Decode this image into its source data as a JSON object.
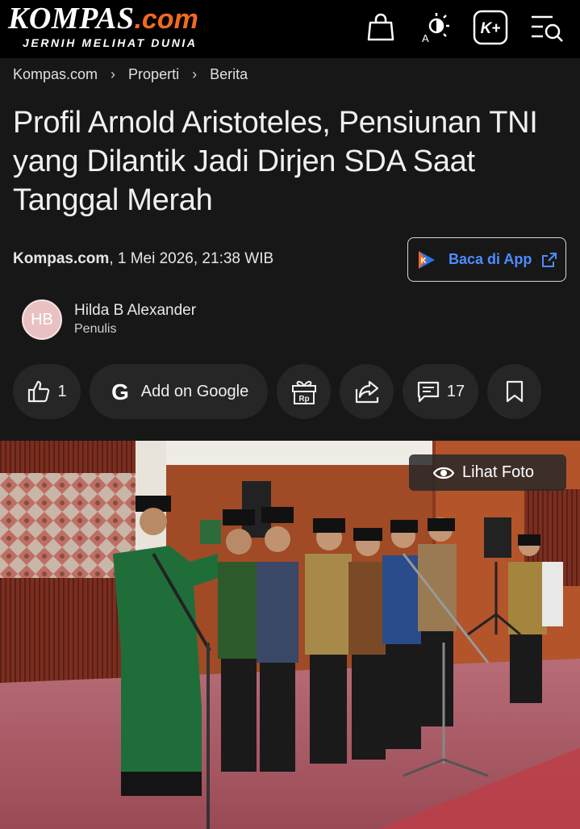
{
  "header": {
    "logo_main": "KOMPAS",
    "logo_domain": ".com",
    "logo_tagline": "JERNIH MELIHAT DUNIA",
    "icons": [
      "shopping-bag-icon",
      "brightness-auto-icon",
      "kplus-icon",
      "menu-search-icon"
    ],
    "kplus_label": "K+",
    "auto_label": "A"
  },
  "breadcrumb": {
    "items": [
      "Kompas.com",
      "Properti",
      "Berita"
    ],
    "separator": "›"
  },
  "article": {
    "title": "Profil Arnold Aristoteles, Pensiunan TNI yang Dilantik Jadi Dirjen SDA Saat Tanggal Merah",
    "source": "Kompas.com",
    "datetime": ", 1 Mei 2026, 21:38 WIB"
  },
  "app_button": {
    "label": "Baca di App",
    "logo_letter": "K"
  },
  "author": {
    "initials": "HB",
    "name": "Hilda B Alexander",
    "role": "Penulis"
  },
  "actions": {
    "like_count": "1",
    "google_label": "Add on Google",
    "google_letter": "G",
    "gift_label": "Rp",
    "comment_count": "17"
  },
  "photo": {
    "view_label": "Lihat Foto"
  },
  "colors": {
    "accent_orange": "#f26a21",
    "link_blue": "#4d8cff",
    "background": "#171717",
    "pill_bg": "#262626"
  }
}
